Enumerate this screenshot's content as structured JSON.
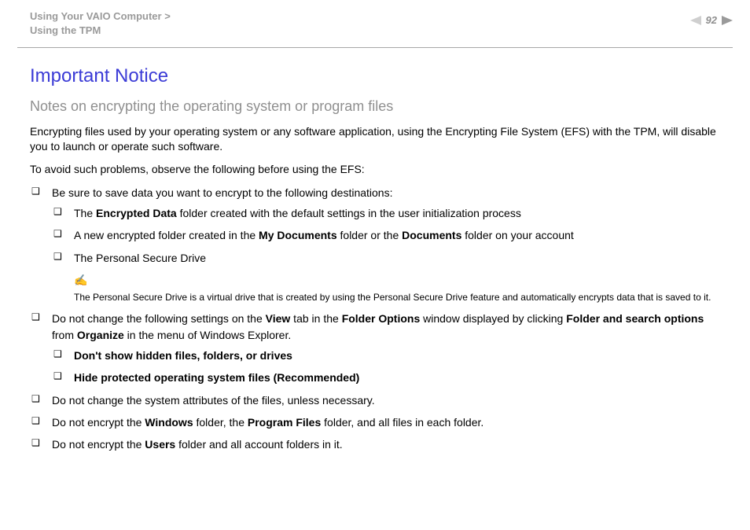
{
  "header": {
    "breadcrumb_line1_prefix": "Using Your VAIO Computer ",
    "breadcrumb_chevron": ">",
    "breadcrumb_line2": "Using the TPM",
    "page_number": "92"
  },
  "content": {
    "title": "Important Notice",
    "subtitle": "Notes on encrypting the operating system or program files",
    "para1": "Encrypting files used by your operating system or any software application, using the Encrypting File System (EFS) with the TPM, will disable you to launch or operate such software.",
    "para2": "To avoid such problems, observe the following before using the EFS:",
    "b1_intro": "Be sure to save data you want to encrypt to the following destinations:",
    "b1_sub1_pre": "The ",
    "b1_sub1_bold": "Encrypted Data",
    "b1_sub1_post": " folder created with the default settings in the user initialization process",
    "b1_sub2_pre": "A new encrypted folder created in the ",
    "b1_sub2_b1": "My Documents",
    "b1_sub2_mid": " folder or the ",
    "b1_sub2_b2": "Documents",
    "b1_sub2_post": " folder on your account",
    "b1_sub3": "The Personal Secure Drive",
    "note_icon": "✍",
    "note_text": "The Personal Secure Drive is a virtual drive that is created by using the Personal Secure Drive feature and automatically encrypts data that is saved to it.",
    "b2_pre": "Do not change the following settings on the ",
    "b2_b1": "View",
    "b2_mid1": " tab in the ",
    "b2_b2": "Folder Options",
    "b2_mid2": " window displayed by clicking ",
    "b2_b3": "Folder and search options",
    "b2_mid3": " from ",
    "b2_b4": "Organize",
    "b2_post": " in the menu of Windows Explorer.",
    "b2_sub1": "Don't show hidden files, folders, or drives",
    "b2_sub2": "Hide protected operating system files (Recommended)",
    "b3": "Do not change the system attributes of the files, unless necessary.",
    "b4_pre": "Do not encrypt the ",
    "b4_b1": "Windows",
    "b4_mid1": " folder, the ",
    "b4_b2": "Program Files",
    "b4_post": " folder, and all files in each folder.",
    "b5_pre": "Do not encrypt the ",
    "b5_b1": "Users",
    "b5_post": " folder and all account folders in it."
  }
}
